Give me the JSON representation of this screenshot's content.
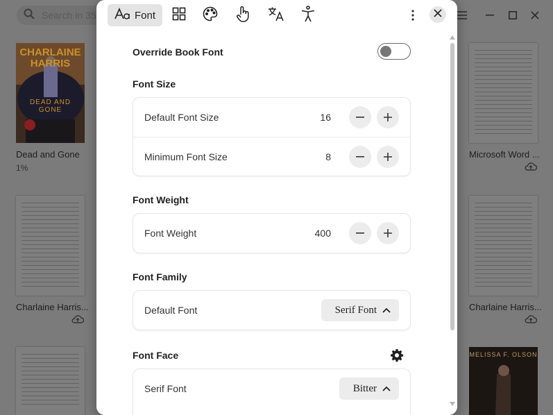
{
  "library": {
    "search_placeholder": "Search in 35",
    "books": [
      {
        "title": "Dead and Gone",
        "progress": "1%",
        "cover_text_author": "CHARLAINE HARRIS",
        "cover_text_title": "DEAD AND GONE"
      },
      {
        "title": "Charlaine Harris..."
      },
      {
        "title": "Microsoft Word ..."
      },
      {
        "title": "Charlaine Harris..."
      },
      {
        "title": "",
        "cover_text_author": "MELISSA F. OLSON"
      }
    ]
  },
  "tabs": [
    {
      "label": "Font",
      "icon": "font-icon",
      "active": true
    },
    {
      "label": "",
      "icon": "layout-icon"
    },
    {
      "label": "",
      "icon": "palette-icon"
    },
    {
      "label": "",
      "icon": "touch-icon"
    },
    {
      "label": "",
      "icon": "translate-icon"
    },
    {
      "label": "",
      "icon": "accessibility-icon"
    }
  ],
  "override": {
    "label": "Override Book Font",
    "enabled": false
  },
  "font_size": {
    "heading": "Font Size",
    "default_label": "Default Font Size",
    "default_value": "16",
    "minimum_label": "Minimum Font Size",
    "minimum_value": "8"
  },
  "font_weight": {
    "heading": "Font Weight",
    "label": "Font Weight",
    "value": "400"
  },
  "font_family": {
    "heading": "Font Family",
    "label": "Default Font",
    "value": "Serif Font"
  },
  "font_face": {
    "heading": "Font Face",
    "serif_label": "Serif Font",
    "serif_value": "Bitter"
  },
  "colors": {
    "overlay": "#7a7a7a",
    "panel": "#ffffff",
    "active_tab": "#e4e4e4"
  }
}
